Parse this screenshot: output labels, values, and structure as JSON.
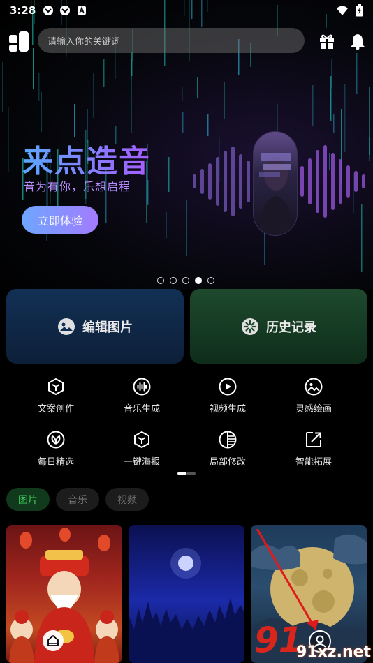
{
  "status_bar": {
    "time": "3:28"
  },
  "search": {
    "placeholder": "请输入你的关键词"
  },
  "banner": {
    "title": "来点造音",
    "subtitle": "音为有你，乐想启程",
    "cta_label": "立即体验",
    "dot_count": 5,
    "active_dot": 4
  },
  "cards": [
    {
      "label": "编辑图片",
      "icon": "image-icon"
    },
    {
      "label": "历史记录",
      "icon": "history-icon"
    }
  ],
  "tools": [
    {
      "label": "文案创作",
      "icon": "cube-icon"
    },
    {
      "label": "音乐生成",
      "icon": "soundwave-icon"
    },
    {
      "label": "视频生成",
      "icon": "play-icon"
    },
    {
      "label": "灵感绘画",
      "icon": "palette-icon"
    },
    {
      "label": "每日精选",
      "icon": "leaf-icon"
    },
    {
      "label": "一键海报",
      "icon": "cube-icon"
    },
    {
      "label": "局部修改",
      "icon": "half-circle-icon"
    },
    {
      "label": "智能拓展",
      "icon": "expand-icon"
    }
  ],
  "filter_tabs": [
    {
      "label": "图片",
      "active": true
    },
    {
      "label": "音乐",
      "active": false
    },
    {
      "label": "视频",
      "active": false
    }
  ],
  "watermark": {
    "number": "91",
    "site": "91xz.net"
  },
  "colors": {
    "accent_green": "#3ecf5b",
    "banner_gradient_start": "#5aa8ff",
    "banner_gradient_end": "#a85cff"
  }
}
